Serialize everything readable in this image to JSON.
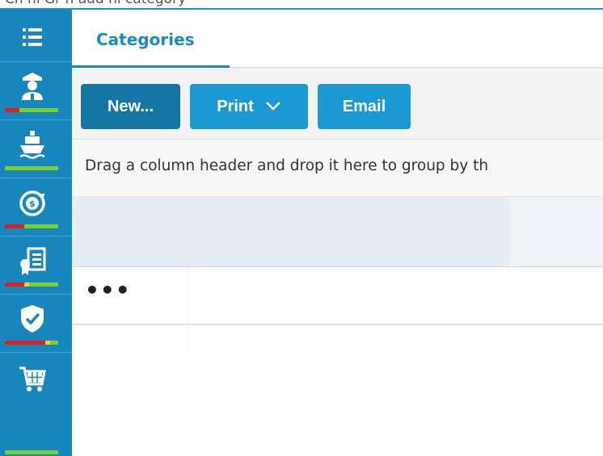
{
  "window": {
    "title_fragment": "Ch  nl  Gr  n  add  nl  category"
  },
  "sidebar": {
    "accent": "#1686bd",
    "items": [
      {
        "icon": "list-icon",
        "label": "Menu"
      },
      {
        "icon": "captain-icon",
        "label": "Crew"
      },
      {
        "icon": "ship-icon",
        "label": "Vessels"
      },
      {
        "icon": "dollar-cycle-icon",
        "label": "Finance"
      },
      {
        "icon": "certificate-icon",
        "label": "Certificates"
      },
      {
        "icon": "shield-check-icon",
        "label": "Safety"
      },
      {
        "icon": "cart-icon",
        "label": "Purchasing"
      }
    ]
  },
  "tabs": [
    {
      "label": "Categories",
      "active": true
    }
  ],
  "toolbar": {
    "new_label": "New...",
    "print_label": "Print",
    "email_label": "Email"
  },
  "grid": {
    "group_panel_text": "Drag a column header and drop it here to group by th",
    "rows": [
      {
        "actions": "•••"
      }
    ]
  },
  "colors": {
    "primary": "#1b99d3",
    "primary_dark": "#1575a5",
    "tab_text": "#1b8bc3",
    "status_red": "#e02020",
    "status_green": "#7ccf2a",
    "status_yellow": "#f0d01a"
  }
}
